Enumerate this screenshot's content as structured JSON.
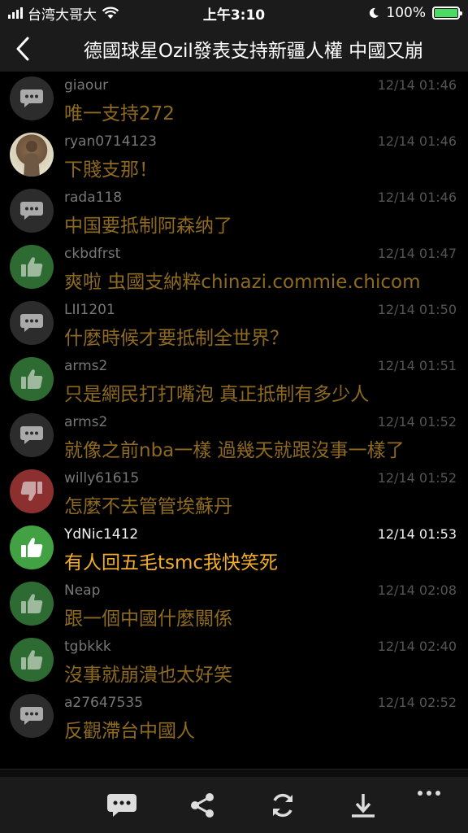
{
  "status": {
    "carrier": "台湾大哥大",
    "time": "上午3:10",
    "battery": "100%"
  },
  "nav": {
    "title": "德國球星Ozil發表支持新疆人權 中國又崩"
  },
  "comments": [
    {
      "user": "giaour",
      "time": "12/14 01:46",
      "text": "唯一支持272",
      "vote": "comment"
    },
    {
      "user": "ryan0714123",
      "time": "12/14 01:46",
      "text": "下賤支那！",
      "vote": "photo"
    },
    {
      "user": "rada118",
      "time": "12/14 01:46",
      "text": "中国要抵制阿森纳了",
      "vote": "comment"
    },
    {
      "user": "ckbdfrst",
      "time": "12/14 01:47",
      "text": "爽啦 虫國支納粹chinazi.commie.chicom",
      "vote": "up"
    },
    {
      "user": "LII1201",
      "time": "12/14 01:50",
      "text": "什麼時候才要抵制全世界？",
      "vote": "comment"
    },
    {
      "user": "arms2",
      "time": "12/14 01:51",
      "text": "只是網民打打嘴泡 真正抵制有多少人",
      "vote": "up"
    },
    {
      "user": "arms2",
      "time": "12/14 01:52",
      "text": "就像之前nba一樣 過幾天就跟沒事一樣了",
      "vote": "comment"
    },
    {
      "user": "willy61615",
      "time": "12/14 01:52",
      "text": "怎麼不去管管埃蘇丹",
      "vote": "down"
    },
    {
      "user": "YdNic1412",
      "time": "12/14 01:53",
      "text": "有人回五毛tsmc我快笑死",
      "vote": "up",
      "highlight": true
    },
    {
      "user": "Neap",
      "time": "12/14 02:08",
      "text": "跟一個中國什麼關係",
      "vote": "up"
    },
    {
      "user": "tgbkkk",
      "time": "12/14 02:40",
      "text": "沒事就崩潰也太好笑",
      "vote": "up"
    },
    {
      "user": "a27647535",
      "time": "12/14 02:52",
      "text": "反觀滯台中國人",
      "vote": "comment"
    }
  ],
  "toolbar": {
    "icons": [
      "comment-icon",
      "share-icon",
      "refresh-icon",
      "download-icon",
      "more-icon"
    ]
  }
}
